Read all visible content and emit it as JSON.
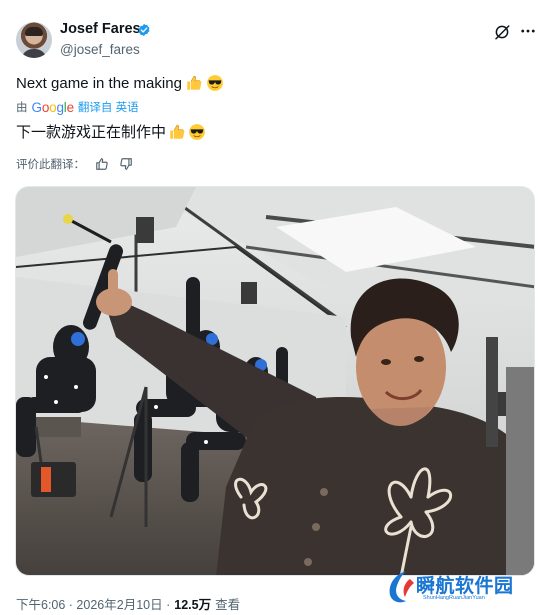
{
  "post": {
    "author": {
      "display_name": "Josef Fares",
      "handle": "@josef_fares",
      "verified": true
    },
    "text": "Next game in the making",
    "translation": {
      "prefix": "由",
      "provider": "Google",
      "action": "翻译自 英语",
      "text": "下一款游戏正在制作中"
    },
    "rate_label": "评价此翻译：",
    "timestamp": "下午6:06 · 2026年2月10日 ·",
    "views_count": "12.5万",
    "views_label": "查看"
  },
  "icons": {
    "verified": "verified-badge-icon",
    "grok": "grok-icon",
    "more": "more-icon",
    "thumbs_up": "thumbs-up-icon",
    "thumbs_down": "thumbs-down-icon"
  },
  "watermark": {
    "title": "瞬航软件园",
    "subtitle": "ShunHangRuanJianYuan"
  },
  "colors": {
    "accent": "#1d9bf0",
    "text": "#0f1419",
    "secondary": "#536471",
    "watermark": "#1976d2"
  }
}
